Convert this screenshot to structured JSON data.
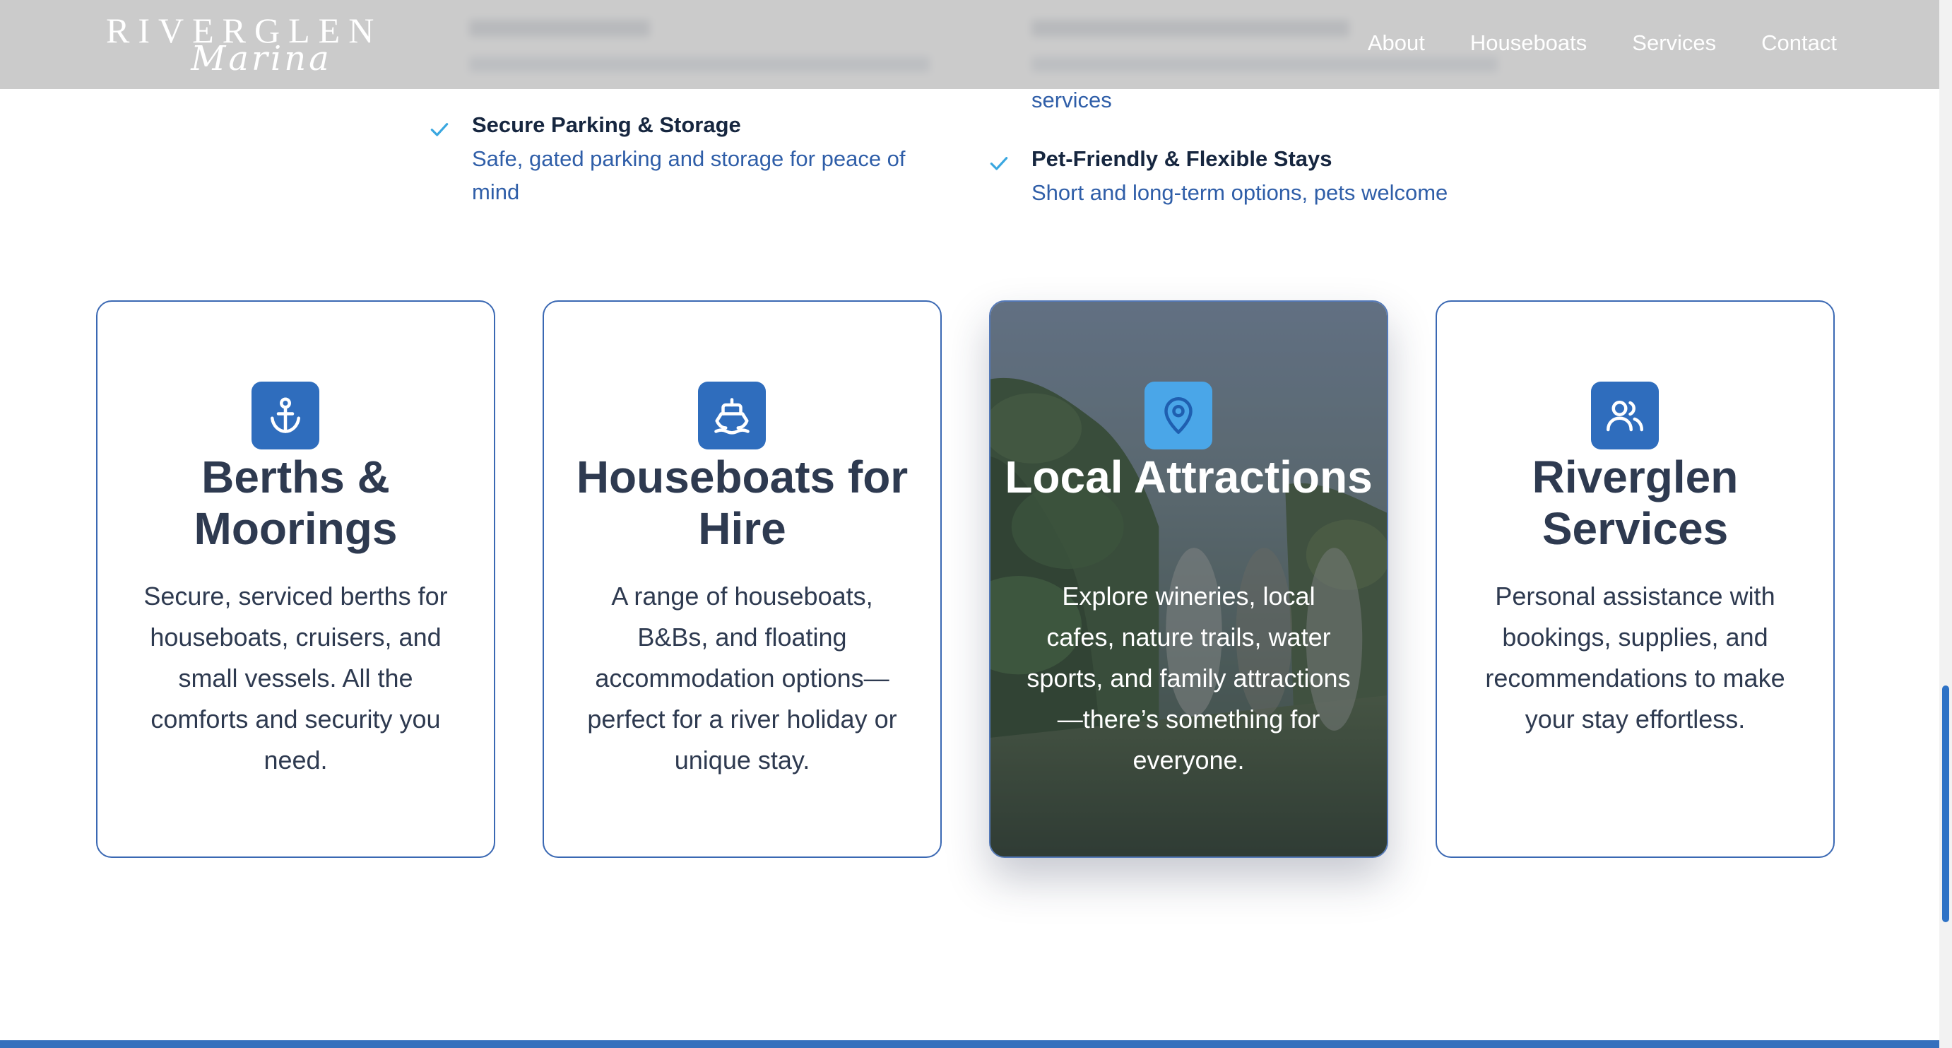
{
  "header": {
    "logo_top": "RIVERGLEN",
    "logo_bottom": "Marina",
    "nav": [
      "About",
      "Houseboats",
      "Services",
      "Contact"
    ]
  },
  "features": {
    "services_fragment": "services",
    "items": [
      {
        "title": "Secure Parking & Storage",
        "description": "Safe, gated parking and storage for peace of mind"
      },
      {
        "title": "Pet-Friendly & Flexible Stays",
        "description": "Short and long-term options, pets welcome"
      }
    ]
  },
  "cards": [
    {
      "icon": "anchor-icon",
      "title": "Berths & Moorings",
      "description": "Secure, serviced berths for houseboats, cruisers, and small vessels. All the comforts and security you need."
    },
    {
      "icon": "ship-icon",
      "title": "Houseboats for Hire",
      "description": "A range of houseboats, B&Bs, and floating accommodation options—perfect for a river holiday or unique stay."
    },
    {
      "icon": "map-pin-icon",
      "title": "Local Attractions",
      "description": "Explore wineries, local cafes, nature trails, water sports, and family attractions—there’s something for everyone."
    },
    {
      "icon": "users-icon",
      "title": "Riverglen Services",
      "description": "Personal assistance with bookings, supplies, and recommendations to make your stay effortless."
    }
  ],
  "colors": {
    "accent": "#2f6dbd",
    "accent_light": "#4aa6e8",
    "heading": "#2e3a50",
    "link_blue": "#2f5ea8",
    "check": "#3aa7e0"
  }
}
